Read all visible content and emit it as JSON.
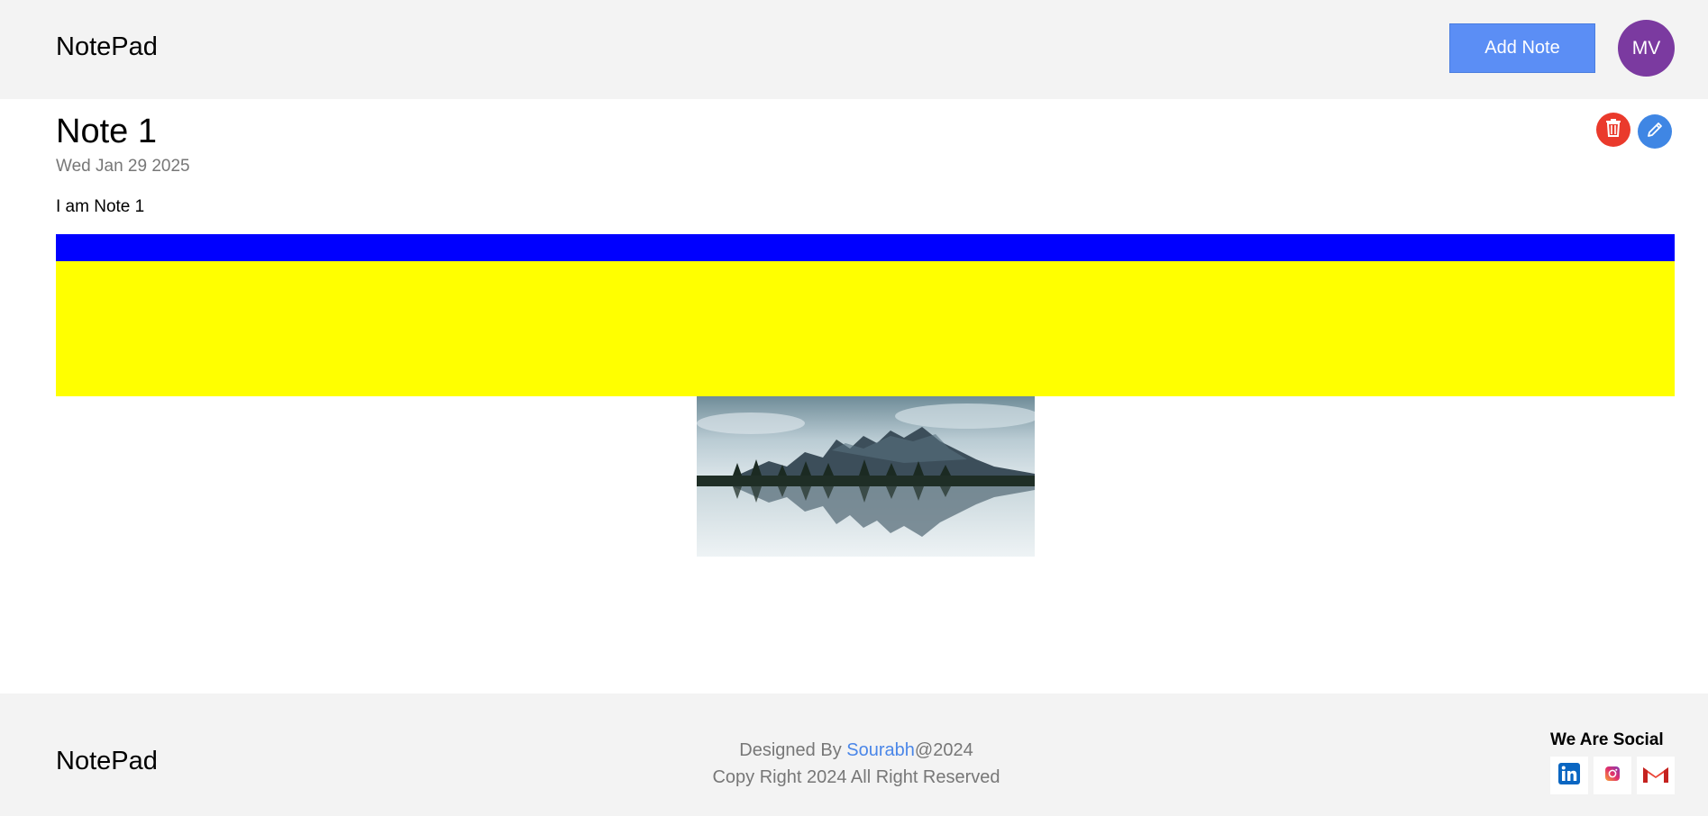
{
  "header": {
    "brand": "NotePad",
    "add_note_label": "Add Note",
    "avatar_initials": "MV"
  },
  "note": {
    "title": "Note 1",
    "date": "Wed Jan 29 2025",
    "body": "I am Note 1",
    "band_colors": {
      "top": "#0000ff",
      "bottom": "#ffff00"
    },
    "image_subject": "mountain-lake-reflection"
  },
  "footer": {
    "brand": "NotePad",
    "designed_by_prefix": "Designed By ",
    "designer_name": "Sourabh",
    "designed_by_suffix": "@2024",
    "copyright": "Copy Right 2024 All Right Reserved",
    "social_title": "We Are Social",
    "social_icons": [
      "linkedin-icon",
      "instagram-icon",
      "gmail-icon"
    ]
  },
  "colors": {
    "accent": "#5b8ef5",
    "avatar": "#7b3aa0",
    "delete": "#ea3a2c",
    "edit": "#3f86e4",
    "link": "#4a86e8"
  }
}
